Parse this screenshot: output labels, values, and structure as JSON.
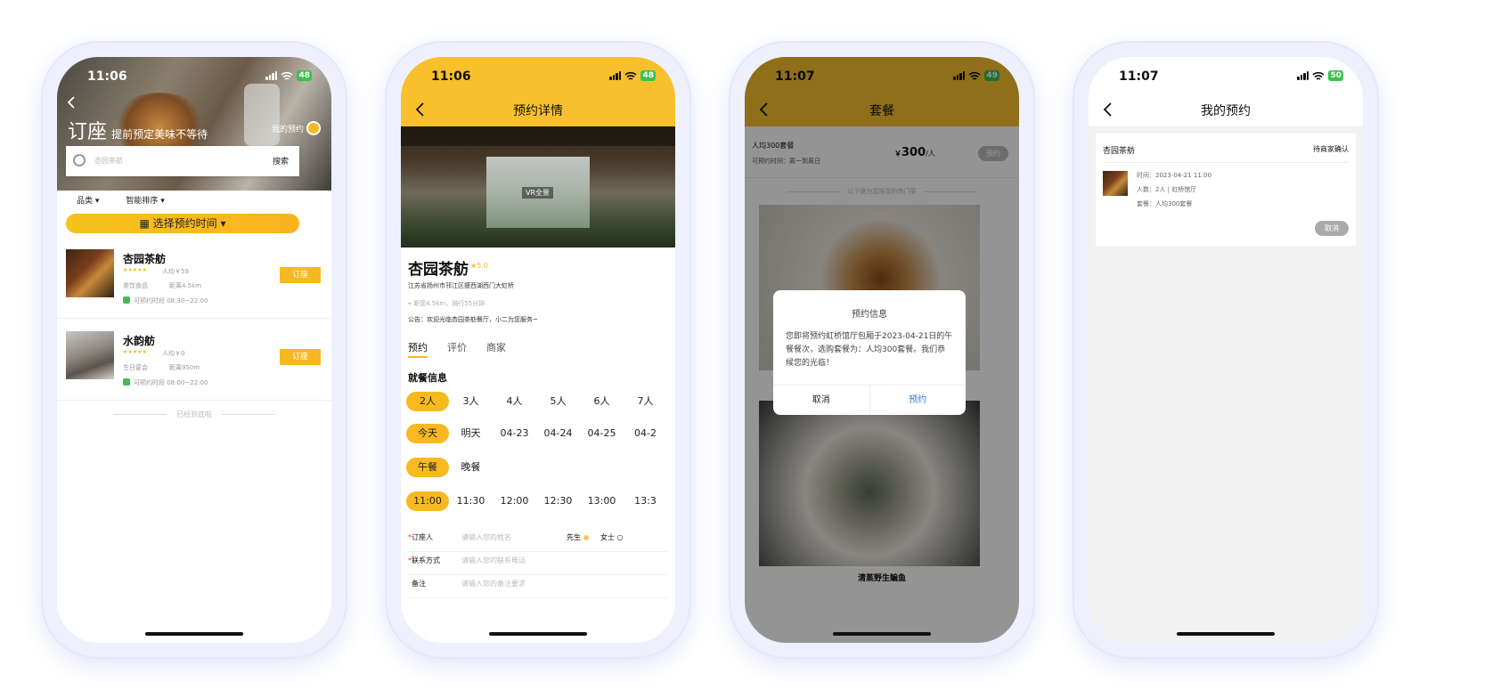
{
  "status": {
    "p1_time": "11:06",
    "p1_batt": "48",
    "p2_time": "11:06",
    "p2_batt": "48",
    "p3_time": "11:07",
    "p3_batt": "49",
    "p4_time": "11:07",
    "p4_batt": "50"
  },
  "p1": {
    "title": "订座",
    "subtitle": "提前预定美味不等待",
    "my_booking": "我的预约",
    "search_placeholder": "杏园茶舫",
    "search_btn": "搜索",
    "filter_category": "品类",
    "filter_sort": "智能排序",
    "time_picker": "选择预约时间",
    "restaurants": [
      {
        "name": "杏园茶舫",
        "stars": "★★★★★",
        "avg": "人均￥59",
        "cat": "茶饮食品",
        "dist": "距离4.5km",
        "hours": "可预约时段 08:30~22:00",
        "btn": "订座"
      },
      {
        "name": "水韵舫",
        "stars": "★★★★★",
        "avg": "人均￥0",
        "cat": "生日宴会",
        "dist": "距离950m",
        "hours": "可预约时段 08:00~22:00",
        "btn": "订座"
      }
    ],
    "end_text": "已经到底啦"
  },
  "p2": {
    "nav_title": "预约详情",
    "vr": "VR全景",
    "name": "杏园茶舫",
    "rating": "5.0",
    "address": "江苏省扬州市邗江区瘦西湖西门大虹桥",
    "distance": "距您4.5km，骑行55分钟",
    "notice": "公告：欢迎光临杏园茶舫餐厅，小二为您服务~",
    "tabs": [
      "预约",
      "评价",
      "商家"
    ],
    "section": "就餐信息",
    "people": [
      "2人",
      "3人",
      "4人",
      "5人",
      "6人",
      "7人"
    ],
    "dates": [
      "今天",
      "明天",
      "04-23",
      "04-24",
      "04-25",
      "04-2"
    ],
    "meals": [
      "午餐",
      "晚餐"
    ],
    "times": [
      "11:00",
      "11:30",
      "12:00",
      "12:30",
      "13:00",
      "13:3"
    ],
    "form": {
      "name_label": "订座人",
      "name_ph": "请输入您的姓名",
      "male": "先生",
      "female": "女士",
      "phone_label": "联系方式",
      "phone_ph": "请输入您的联系电话",
      "note_label": "备注",
      "note_ph": "请输入您的备注要求"
    }
  },
  "p3": {
    "nav_title": "套餐",
    "pkg_name": "人均300套餐",
    "pkg_time": "可预约时间：周一到周日",
    "price_sym": "￥",
    "price": "300",
    "price_unit": "/人",
    "pkg_btn": "预约",
    "divider": "以下是为您推荐的热门菜",
    "dish_caption": "清蒸野生鳊鱼",
    "dialog": {
      "title": "预约信息",
      "body": "您即将预约虹桥馆厅包厢于2023-04-21日的午餐餐次，选购套餐为：人均300套餐。我们恭候您的光临！",
      "cancel": "取消",
      "confirm": "预约"
    }
  },
  "p4": {
    "nav_title": "我的预约",
    "shop": "杏园茶舫",
    "state": "待商家确认",
    "time_line": "时间：2023-04-21 11:00",
    "people_line": "人数：2人 | 虹桥馆厅",
    "pkg_line": "套餐：人均300套餐",
    "cancel": "取消"
  },
  "colors": {
    "accent": "#f7b91f",
    "nav": "#f9c02d",
    "confirm": "#2f7bd9",
    "open": "#47b85a"
  }
}
